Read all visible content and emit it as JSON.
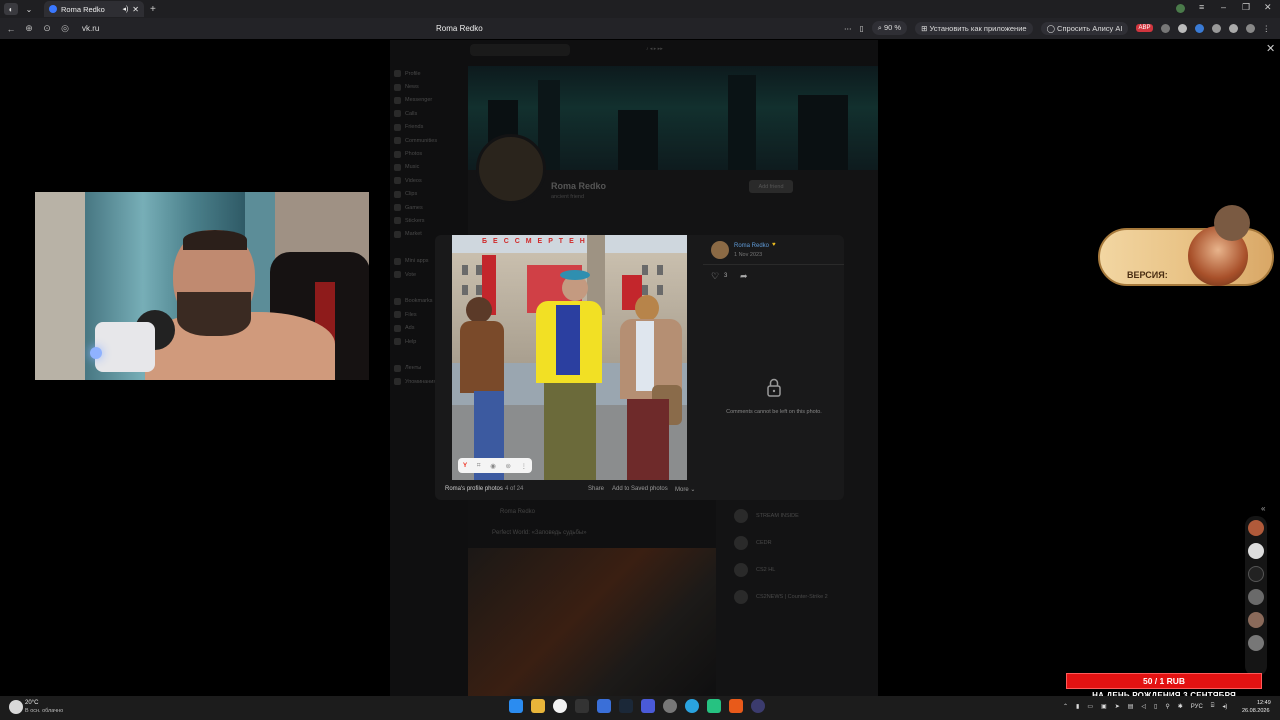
{
  "browser": {
    "tab_title": "Roma Redko",
    "url": "vk.ru",
    "page_title": "Roma Redko",
    "zoom": "90 %",
    "install_app": "Установить как приложение",
    "ask_alice": "Спросить Алису AI"
  },
  "vk": {
    "sidebar": [
      "Profile",
      "News",
      "Messenger",
      "Calls",
      "Friends",
      "Communities",
      "Photos",
      "Music",
      "Videos",
      "Clips",
      "Games",
      "Stickers",
      "Market",
      "",
      "Mini apps",
      "Vote",
      "",
      "Bookmarks",
      "Files",
      "Ads",
      "Help",
      "",
      "Ленты",
      "Упоминания"
    ],
    "profile_name": "Roma Redko",
    "profile_status": "ancient friend",
    "add_friend": "Add friend",
    "more": "More",
    "post_author": "Roma Redko",
    "post_text": "Perfect World: «Заповедь судьбы»",
    "groups": [
      "STREAM INSIDE",
      "CEDR",
      "CS2 HL",
      "CS2NEWS | Counter-Strike 2"
    ]
  },
  "viewer": {
    "author": "Roma Redko",
    "date": "1 Nov 2023",
    "likes": "3",
    "no_comments": "Comments cannot be left on this photo.",
    "caption": "Roma's profile photos",
    "counter": "4 of 24",
    "share": "Share",
    "save": "Add to Saved photos",
    "more": "More",
    "photo_sign": "БЕССМЕРТЕН"
  },
  "overlay": {
    "game_label": "ВЕРСИЯ:",
    "donation_amount": "50 / 1 RUB",
    "donation_text": "НА ДЕНЬ РОЖДЕНИЯ 3 СЕНТЯБРЯ"
  },
  "taskbar": {
    "temp": "20°C",
    "weather": "В осн. облачно",
    "lang": "РУС",
    "time": "12:49",
    "date": "26.08.2026"
  },
  "colors": {
    "accent_vk": "#5f9bd8",
    "donation_red": "#e31212"
  }
}
